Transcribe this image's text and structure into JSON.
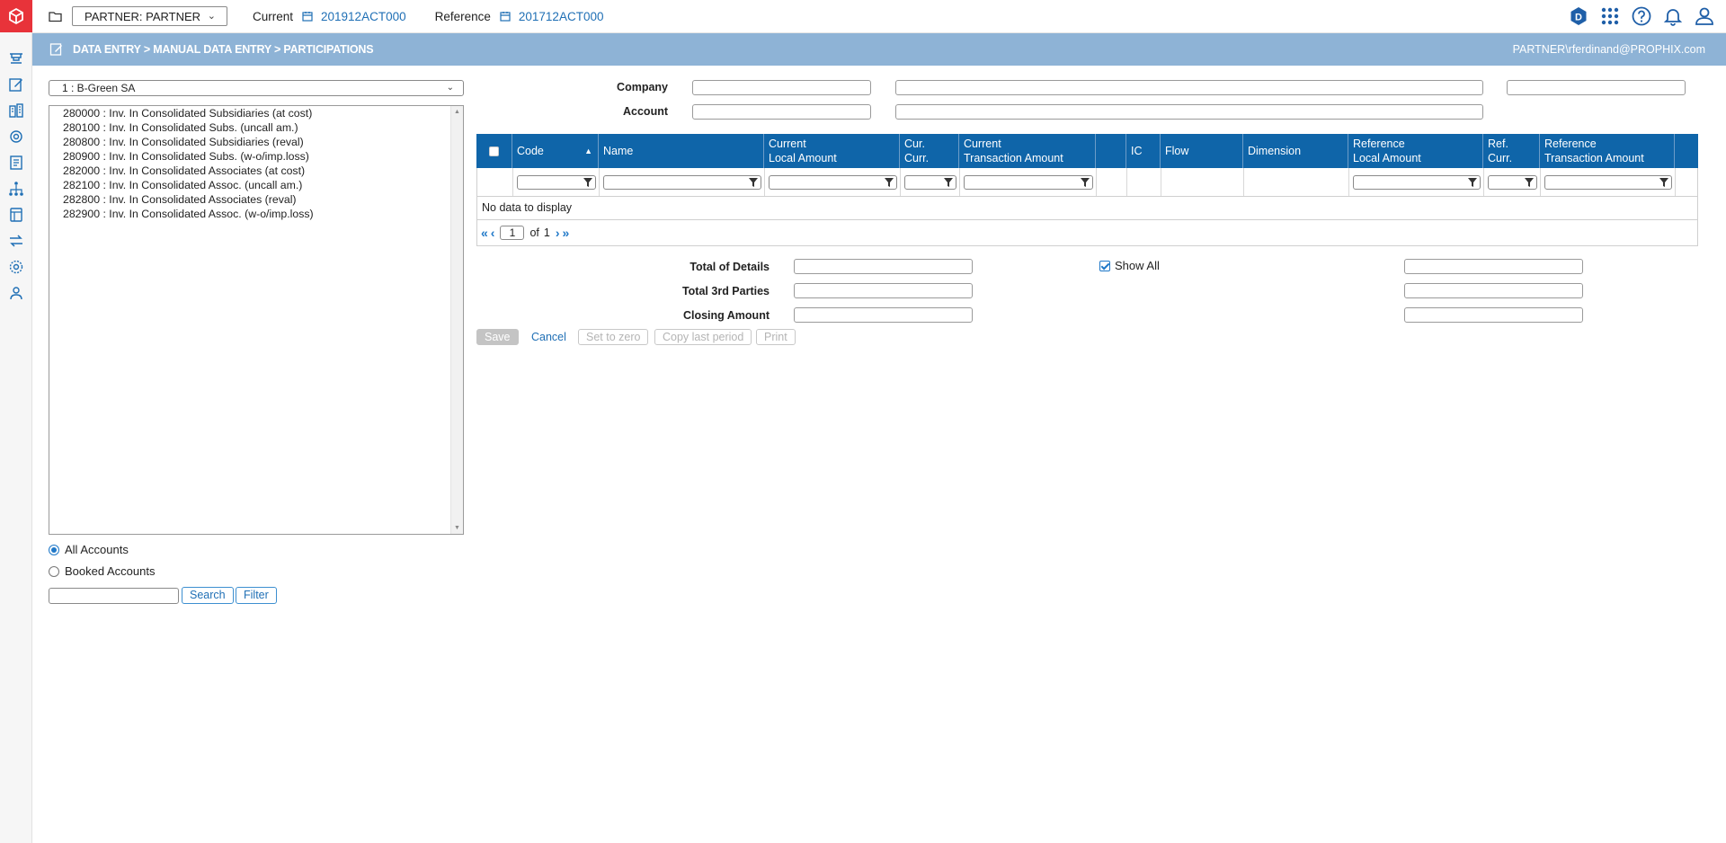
{
  "topbar": {
    "partner_select": "PARTNER: PARTNER",
    "current_label": "Current",
    "current_value": "201912ACT000",
    "reference_label": "Reference",
    "reference_value": "201712ACT000",
    "badge_letter": "D"
  },
  "band": {
    "breadcrumb": "DATA ENTRY > MANUAL DATA ENTRY > PARTICIPATIONS",
    "user": "PARTNER\\rferdinand@PROPHIX.com"
  },
  "left": {
    "entity_select": "1 : B-Green SA",
    "accounts": [
      "280000 : Inv. In Consolidated Subsidiaries (at cost)",
      "280100 : Inv. In Consolidated Subs. (uncall am.)",
      "280800 : Inv. In Consolidated Subsidiaries (reval)",
      "280900 : Inv. In Consolidated Subs. (w-o/imp.loss)",
      "282000 : Inv. In Consolidated Associates (at cost)",
      "282100 : Inv. In Consolidated Assoc. (uncall am.)",
      "282800 : Inv. In Consolidated Associates (reval)",
      "282900 : Inv. In Consolidated Assoc. (w-o/imp.loss)"
    ],
    "radio_all": "All Accounts",
    "radio_booked": "Booked Accounts",
    "search_button": "Search",
    "filter_button": "Filter"
  },
  "filters": {
    "company_label": "Company",
    "account_label": "Account"
  },
  "grid": {
    "col_code": "Code",
    "col_name": "Name",
    "col_cur_local_1": "Current",
    "col_cur_local_2": "Local Amount",
    "col_cur_curr_1": "Cur.",
    "col_cur_curr_2": "Curr.",
    "col_cur_trans_1": "Current",
    "col_cur_trans_2": "Transaction Amount",
    "col_ic": "IC",
    "col_flow": "Flow",
    "col_dimension": "Dimension",
    "col_ref_local_1": "Reference",
    "col_ref_local_2": "Local Amount",
    "col_ref_curr_1": "Ref.",
    "col_ref_curr_2": "Curr.",
    "col_ref_trans_1": "Reference",
    "col_ref_trans_2": "Transaction Amount",
    "no_data": "No data to display",
    "page": "1",
    "page_of": "of",
    "page_total": "1"
  },
  "totals": {
    "total_details": "Total of Details",
    "total_3rd": "Total 3rd Parties",
    "closing": "Closing Amount",
    "show_all": "Show All"
  },
  "actions": {
    "save": "Save",
    "cancel": "Cancel",
    "set_zero": "Set to zero",
    "copy_last": "Copy last period",
    "print": "Print"
  },
  "colors": {
    "brand_red": "#e8333a",
    "band_blue": "#8eb3d6",
    "grid_header": "#0f65a9",
    "link_blue": "#1f6fb5"
  }
}
